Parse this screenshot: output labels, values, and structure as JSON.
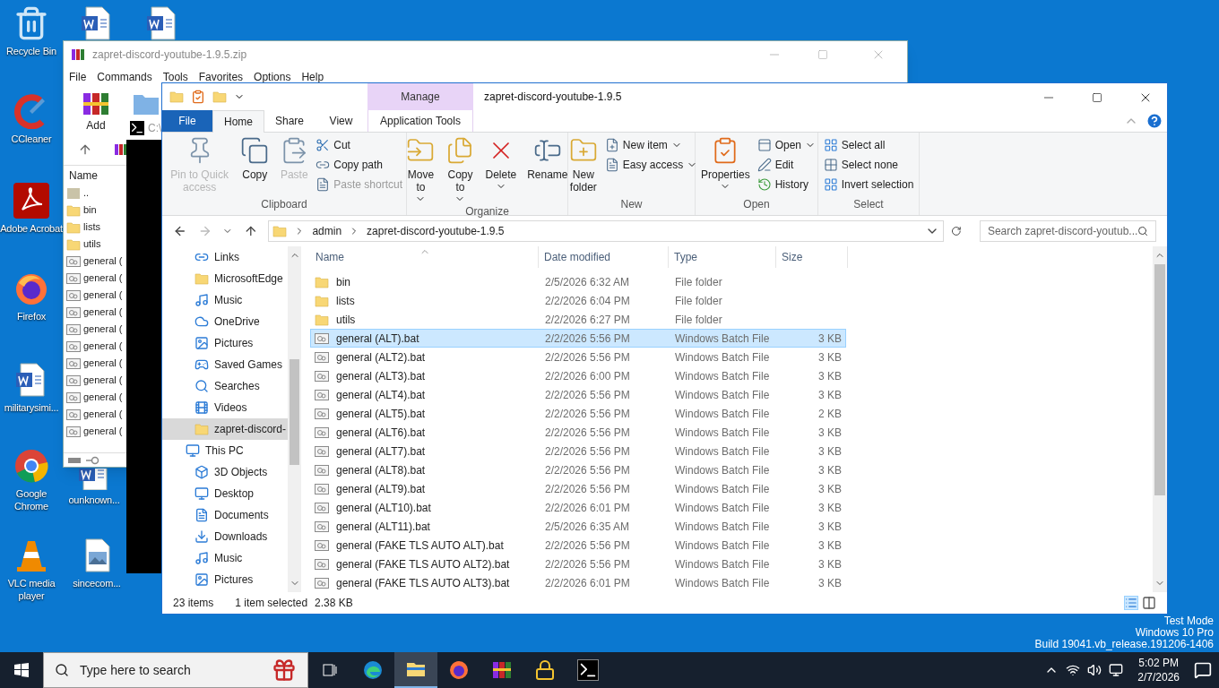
{
  "desktop": {
    "icons": [
      {
        "label": "Recycle Bin",
        "kind": "recycle"
      },
      {
        "label": "CCleaner",
        "kind": "ccleaner"
      },
      {
        "label": "Adobe Acrobat",
        "kind": "acrobat"
      },
      {
        "label": "Firefox",
        "kind": "firefox"
      },
      {
        "label": "militarysimi...",
        "kind": "word"
      },
      {
        "label": "Google Chrome",
        "kind": "chrome"
      },
      {
        "label": "VLC media player",
        "kind": "vlc"
      },
      {
        "kind": "word"
      },
      {
        "kind": "word"
      },
      {
        "label": "ounknown...",
        "kind": "word"
      },
      {
        "label": "sincecom...",
        "kind": "image"
      }
    ],
    "notice": [
      "Test Mode",
      "Windows 10 Pro",
      "Build 19041.vb_release.191206-1406"
    ]
  },
  "winrar": {
    "title": "zapret-discord-youtube-1.9.5.zip",
    "menu": [
      "File",
      "Commands",
      "Tools",
      "Favorites",
      "Options",
      "Help"
    ],
    "toolbar": [
      "Add"
    ],
    "column": "Name",
    "rows": [
      {
        "name": "..",
        "kind": "parent"
      },
      {
        "name": "bin",
        "kind": "folder"
      },
      {
        "name": "lists",
        "kind": "folder"
      },
      {
        "name": "utils",
        "kind": "folder"
      },
      {
        "name": "general (",
        "kind": "bat"
      },
      {
        "name": "general (",
        "kind": "bat"
      },
      {
        "name": "general (",
        "kind": "bat"
      },
      {
        "name": "general (",
        "kind": "bat"
      },
      {
        "name": "general (",
        "kind": "bat"
      },
      {
        "name": "general (",
        "kind": "bat"
      },
      {
        "name": "general (",
        "kind": "bat"
      },
      {
        "name": "general (",
        "kind": "bat"
      },
      {
        "name": "general (",
        "kind": "bat"
      },
      {
        "name": "general (",
        "kind": "bat"
      },
      {
        "name": "general (",
        "kind": "bat"
      }
    ]
  },
  "cmd": {
    "title": "C:\\"
  },
  "explorer": {
    "title": "zapret-discord-youtube-1.9.5",
    "context_header": "Manage",
    "tabs": [
      {
        "label": "File",
        "kind": "file",
        "selected": false
      },
      {
        "label": "Home",
        "kind": "normal",
        "selected": true
      },
      {
        "label": "Share",
        "kind": "normal",
        "selected": false
      },
      {
        "label": "View",
        "kind": "normal",
        "selected": false
      },
      {
        "label": "Application Tools",
        "kind": "contextual",
        "selected": false
      }
    ],
    "ribbon": [
      {
        "label": "Clipboard",
        "items": [
          {
            "label": "Pin to Quick access",
            "kind": "large",
            "disabled": true
          },
          {
            "label": "Copy",
            "kind": "large",
            "disabled": false
          },
          {
            "label": "Paste",
            "kind": "large",
            "disabled": true
          },
          {
            "kind": "stack",
            "items": [
              {
                "label": "Cut",
                "disabled": false
              },
              {
                "label": "Copy path",
                "disabled": false
              },
              {
                "label": "Paste shortcut",
                "disabled": true
              }
            ]
          }
        ]
      },
      {
        "label": "Organize",
        "items": [
          {
            "label": "Move to",
            "kind": "large",
            "disabled": false,
            "dropdown": true
          },
          {
            "label": "Copy to",
            "kind": "large",
            "disabled": false,
            "dropdown": true
          },
          {
            "label": "Delete",
            "kind": "large",
            "disabled": false,
            "dropdown": true
          },
          {
            "label": "Rename",
            "kind": "large",
            "disabled": false
          }
        ]
      },
      {
        "label": "New",
        "items": [
          {
            "label": "New folder",
            "kind": "large",
            "disabled": false
          },
          {
            "kind": "stack",
            "items": [
              {
                "label": "New item",
                "disabled": false,
                "dropdown": true
              },
              {
                "label": "Easy access",
                "disabled": false,
                "dropdown": true
              }
            ]
          }
        ]
      },
      {
        "label": "Open",
        "items": [
          {
            "label": "Properties",
            "kind": "large",
            "disabled": false,
            "dropdown": true
          },
          {
            "kind": "stack",
            "items": [
              {
                "label": "Open",
                "disabled": false,
                "dropdown": true
              },
              {
                "label": "Edit",
                "disabled": false
              },
              {
                "label": "History",
                "disabled": false
              }
            ]
          }
        ]
      },
      {
        "label": "Select",
        "items": [
          {
            "kind": "stack",
            "items": [
              {
                "label": "Select all",
                "disabled": false
              },
              {
                "label": "Select none",
                "disabled": false
              },
              {
                "label": "Invert selection",
                "disabled": false
              }
            ]
          }
        ]
      }
    ],
    "path": [
      "admin",
      "zapret-discord-youtube-1.9.5"
    ],
    "search": {
      "placeholder": "Search zapret-discord-youtub..."
    },
    "nav": {
      "items": [
        {
          "label": "Links",
          "selected": false
        },
        {
          "label": "MicrosoftEdge",
          "selected": false
        },
        {
          "label": "Music",
          "selected": false
        },
        {
          "label": "OneDrive",
          "selected": false
        },
        {
          "label": "Pictures",
          "selected": false
        },
        {
          "label": "Saved Games",
          "selected": false
        },
        {
          "label": "Searches",
          "selected": false
        },
        {
          "label": "Videos",
          "selected": false
        },
        {
          "label": "zapret-discord-",
          "selected": true
        },
        {
          "label": "This PC",
          "selected": false,
          "children": [
            {
              "label": "3D Objects",
              "selected": false
            },
            {
              "label": "Desktop",
              "selected": false
            },
            {
              "label": "Documents",
              "selected": false
            },
            {
              "label": "Downloads",
              "selected": false
            },
            {
              "label": "Music",
              "selected": false
            },
            {
              "label": "Pictures",
              "selected": false
            }
          ]
        }
      ]
    },
    "columns": [
      "Name",
      "Date modified",
      "Type",
      "Size"
    ],
    "files": [
      {
        "name": "bin",
        "date": "2/5/2026 6:32 AM",
        "type": "File folder",
        "kind": "folder",
        "selected": false
      },
      {
        "name": "lists",
        "date": "2/2/2026 6:04 PM",
        "type": "File folder",
        "kind": "folder",
        "selected": false
      },
      {
        "name": "utils",
        "date": "2/2/2026 6:27 PM",
        "type": "File folder",
        "kind": "folder",
        "selected": false
      },
      {
        "name": "general (ALT).bat",
        "date": "2/2/2026 5:56 PM",
        "type": "Windows Batch File",
        "size": "3 KB",
        "kind": "bat",
        "selected": true
      },
      {
        "name": "general (ALT2).bat",
        "date": "2/2/2026 5:56 PM",
        "type": "Windows Batch File",
        "size": "3 KB",
        "kind": "bat",
        "selected": false
      },
      {
        "name": "general (ALT3).bat",
        "date": "2/2/2026 6:00 PM",
        "type": "Windows Batch File",
        "size": "3 KB",
        "kind": "bat",
        "selected": false
      },
      {
        "name": "general (ALT4).bat",
        "date": "2/2/2026 5:56 PM",
        "type": "Windows Batch File",
        "size": "3 KB",
        "kind": "bat",
        "selected": false
      },
      {
        "name": "general (ALT5).bat",
        "date": "2/2/2026 5:56 PM",
        "type": "Windows Batch File",
        "size": "2 KB",
        "kind": "bat",
        "selected": false
      },
      {
        "name": "general (ALT6).bat",
        "date": "2/2/2026 5:56 PM",
        "type": "Windows Batch File",
        "size": "3 KB",
        "kind": "bat",
        "selected": false
      },
      {
        "name": "general (ALT7).bat",
        "date": "2/2/2026 5:56 PM",
        "type": "Windows Batch File",
        "size": "3 KB",
        "kind": "bat",
        "selected": false
      },
      {
        "name": "general (ALT8).bat",
        "date": "2/2/2026 5:56 PM",
        "type": "Windows Batch File",
        "size": "3 KB",
        "kind": "bat",
        "selected": false
      },
      {
        "name": "general (ALT9).bat",
        "date": "2/2/2026 5:56 PM",
        "type": "Windows Batch File",
        "size": "3 KB",
        "kind": "bat",
        "selected": false
      },
      {
        "name": "general (ALT10).bat",
        "date": "2/2/2026 6:01 PM",
        "type": "Windows Batch File",
        "size": "3 KB",
        "kind": "bat",
        "selected": false
      },
      {
        "name": "general (ALT11).bat",
        "date": "2/5/2026 6:35 AM",
        "type": "Windows Batch File",
        "size": "3 KB",
        "kind": "bat",
        "selected": false
      },
      {
        "name": "general (FAKE TLS AUTO ALT).bat",
        "date": "2/2/2026 5:56 PM",
        "type": "Windows Batch File",
        "size": "3 KB",
        "kind": "bat",
        "selected": false
      },
      {
        "name": "general (FAKE TLS AUTO ALT2).bat",
        "date": "2/2/2026 5:56 PM",
        "type": "Windows Batch File",
        "size": "3 KB",
        "kind": "bat",
        "selected": false
      },
      {
        "name": "general (FAKE TLS AUTO ALT3).bat",
        "date": "2/2/2026 6:01 PM",
        "type": "Windows Batch File",
        "size": "3 KB",
        "kind": "bat",
        "selected": false
      }
    ],
    "status": {
      "count": "23 items",
      "selection": "1 item selected",
      "size": "2.38 KB"
    }
  },
  "taskbar": {
    "search": {
      "placeholder": "Type here to search"
    },
    "apps": [
      {
        "kind": "taskview",
        "active": false
      },
      {
        "kind": "edge",
        "active": false
      },
      {
        "kind": "explorer",
        "active": true
      },
      {
        "kind": "firefox",
        "active": false
      },
      {
        "kind": "winrar",
        "active": false
      },
      {
        "kind": "lock",
        "active": false
      },
      {
        "kind": "cmd",
        "active": false
      }
    ],
    "time": "5:02 PM",
    "date": "2/7/2026"
  }
}
